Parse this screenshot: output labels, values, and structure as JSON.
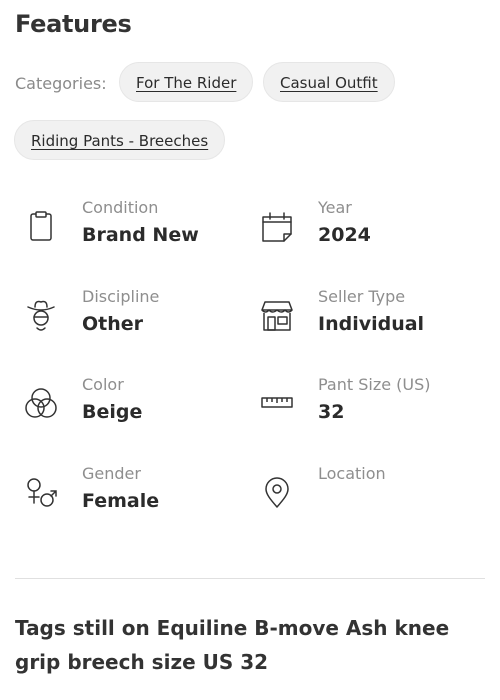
{
  "section_title": "Features",
  "categories": {
    "label": "Categories:",
    "chips": [
      "For The Rider",
      "Casual Outfit",
      "Riding Pants - Breeches"
    ]
  },
  "features": [
    {
      "icon": "clipboard-icon",
      "label": "Condition",
      "value": "Brand New"
    },
    {
      "icon": "calendar-icon",
      "label": "Year",
      "value": "2024"
    },
    {
      "icon": "rider-icon",
      "label": "Discipline",
      "value": "Other"
    },
    {
      "icon": "storefront-icon",
      "label": "Seller Type",
      "value": "Individual"
    },
    {
      "icon": "color-circles-icon",
      "label": "Color",
      "value": "Beige"
    },
    {
      "icon": "ruler-icon",
      "label": "Pant Size (US)",
      "value": "32"
    },
    {
      "icon": "gender-icon",
      "label": "Gender",
      "value": "Female"
    },
    {
      "icon": "location-pin-icon",
      "label": "Location",
      "value": ""
    }
  ],
  "description": "Tags still on Equiline B-move Ash knee grip breech size US 32"
}
